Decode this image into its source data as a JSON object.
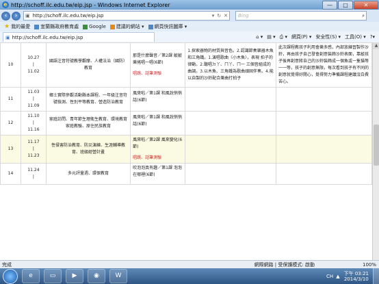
{
  "window": {
    "title": "http://schoff.ilc.edu.tw/eip.jsp - Windows Internet Explorer",
    "minimize": "—",
    "maximize": "□",
    "close": "✕"
  },
  "address": {
    "url": "http://schoff.ilc.edu.tw/eip.jsp",
    "search_placeholder": "Bing"
  },
  "favorites": {
    "label": "我的最愛",
    "items": [
      "宜蘭縣政府教育處",
      "Google",
      "建議的網站 ▾",
      "網頁快訊圖庫 ▾"
    ]
  },
  "tab": {
    "title": "http://schoff.ilc.edu.tw/eip.jsp"
  },
  "commands": [
    "網頁(P) ▾",
    "安全性(S) ▾",
    "工具(O) ▾",
    "?▾"
  ],
  "rows": [
    {
      "num": "10",
      "date_start": "10.27",
      "date_end": "11.02",
      "sep": "|",
      "topic": "國語注音符號教學觀摩、人權法治（國防）教育",
      "unit": "那是什麼聲音／第2課 敲敲樂搖唱一唱(6節)",
      "note": "唱跳、話筆測驗",
      "obj": "1.探索器物的材質與音色。2.認識節奏樂器木魚和三角鐵。1.演唱歌曲〈小木魚〉，表現 拍子的律動。2.聽唱ㄉ丫、ㄇ丫、ㄇ一 三個音組成的曲調。3.以木魚、三角鐵為歌曲頑固伴奏。4.能以自製的沙鈴配合樂曲打拍子",
      "act": "此次課程教孩子利用會樂多感，內部放練習製作沙鈴，再由孩子自己發會創意裝飾沙鈴表面，靠敲孩子後再創意將自己的沙鈴裝飾成一個魚或一隻貓等一一等，孩子的創意無限，每次看到孩子有不同的創意就覺得好開心，覺得努力準備課程建議沒白費苦心。",
      "hl": false
    },
    {
      "num": "11",
      "date_start": "11.03",
      "date_end": "11.09",
      "sep": "|",
      "topic": "鄉土實際參觀活動縣本課程、一年級注音符號檢測、性別平等教育、營造防治教育",
      "unit": "風來啦／第1課 和風說悄悄話(6節)",
      "note": "",
      "obj": "",
      "act": "",
      "hl": false
    },
    {
      "num": "12",
      "date_start": "11.10",
      "date_end": "11.16",
      "sep": "|",
      "topic": "家庭訪問、青年節生理衛生教育、環境教育家庭教驗、原住民族教育",
      "unit": "風來啦／第1課 和風說悄悄話(6節)",
      "note": "",
      "obj": "",
      "act": "",
      "hl": false
    },
    {
      "num": "13",
      "date_start": "11.17",
      "date_end": "11.23",
      "sep": "|",
      "topic": "性侵害防治教育、防災演練、生涯輔導教育、班級經營計畫",
      "unit": "風來啦／第2課 風來變化(6節)",
      "note": "唱跳、話筆測驗",
      "obj": "",
      "act": "",
      "hl": true
    },
    {
      "num": "14",
      "date_start": "11.24",
      "date_end": "",
      "sep": "|",
      "topic": "多元評量週、環保教育",
      "unit": "吹泡泡真有趣／第1課 泡泡在哪裡(6節)",
      "note": "",
      "obj": "",
      "act": "",
      "hl": false
    }
  ],
  "status": {
    "left": "完成",
    "zone": "網際網路 | 受保護模式: 啟動",
    "zoom": "100%"
  },
  "taskbar": {
    "time": "下午 03:21",
    "date": "2014/3/10",
    "lang": "CH"
  }
}
